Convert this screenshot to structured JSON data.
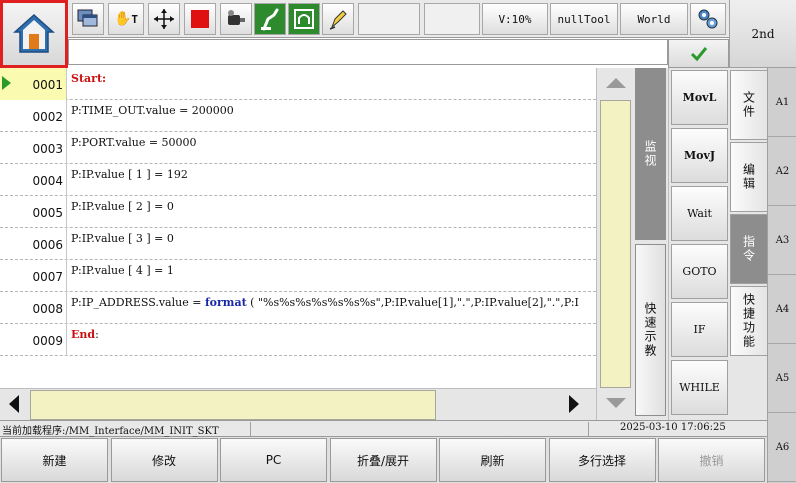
{
  "toolbar": {
    "speed": "V:10%",
    "tool": "nullTool",
    "frame": "World",
    "hand_t_label": "T"
  },
  "second_key": "2nd",
  "code_lines": [
    {
      "n": "0001",
      "parts": [
        {
          "t": "Start",
          "c": "kw"
        },
        {
          "t": ":",
          "c": "kw"
        }
      ]
    },
    {
      "n": "0002",
      "parts": [
        {
          "t": "P:TIME_OUT.value = 200000",
          "c": ""
        }
      ]
    },
    {
      "n": "0003",
      "parts": [
        {
          "t": "P:PORT.value = 50000",
          "c": ""
        }
      ]
    },
    {
      "n": "0004",
      "parts": [
        {
          "t": "P:IP.value [ 1 ] = 192",
          "c": ""
        }
      ]
    },
    {
      "n": "0005",
      "parts": [
        {
          "t": "P:IP.value [ 2 ] = 0",
          "c": ""
        }
      ]
    },
    {
      "n": "0006",
      "parts": [
        {
          "t": "P:IP.value [ 3 ] = 0",
          "c": ""
        }
      ]
    },
    {
      "n": "0007",
      "parts": [
        {
          "t": "P:IP.value [ 4 ] = 1",
          "c": ""
        }
      ]
    },
    {
      "n": "0008",
      "parts": [
        {
          "t": "P:IP_ADDRESS.value = ",
          "c": ""
        },
        {
          "t": "format",
          "c": "fn"
        },
        {
          "t": " ( \"%s%s%s%s%s%s%s\",P:IP.value[1],\".\",P:IP.value[2],\".\",P:I",
          "c": ""
        }
      ]
    },
    {
      "n": "0009",
      "parts": [
        {
          "t": "End",
          "c": "kw"
        },
        {
          "t": ":",
          "c": ""
        }
      ]
    }
  ],
  "side_tabs": {
    "monitor": "监视",
    "quick": "快速示教"
  },
  "instructions": [
    "MovL",
    "MovJ",
    "Wait",
    "GOTO",
    "IF",
    "WHILE"
  ],
  "categories": [
    "文件",
    "编辑",
    "指令",
    "快捷功能"
  ],
  "selected_category": "指令",
  "a_keys": [
    "A1",
    "A2",
    "A3",
    "A4",
    "A5",
    "A6"
  ],
  "status": {
    "program": "当前加载程序:/MM_Interface/MM_INIT_SKT",
    "datetime": "2025-03-10  17:06:25"
  },
  "bottom_buttons": [
    "新建",
    "修改",
    "PC",
    "折叠/展开",
    "刷新",
    "多行选择",
    "撤销"
  ],
  "colors": {
    "keyword": "#cc1010",
    "function": "#1a28a8",
    "active_line": "#fafab0",
    "home_border": "#e02020"
  }
}
